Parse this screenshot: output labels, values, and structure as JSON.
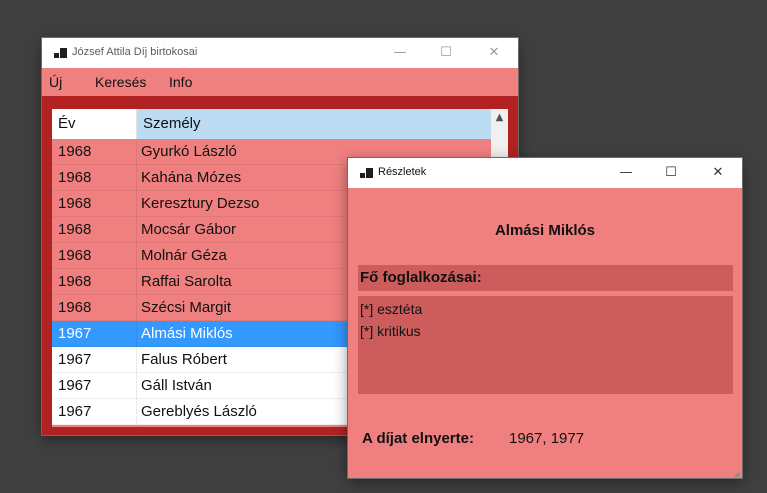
{
  "main_window": {
    "title": "József Attila Díj birtokosai",
    "menu": [
      "Új",
      "Keresés",
      "Info"
    ],
    "list": {
      "columns": [
        "Év",
        "Személy"
      ],
      "rows": [
        {
          "ev": "1968",
          "szemely": "Gyurkó László"
        },
        {
          "ev": "1968",
          "szemely": "Kahána Mózes"
        },
        {
          "ev": "1968",
          "szemely": "Keresztury Dezso"
        },
        {
          "ev": "1968",
          "szemely": "Mocsár Gábor"
        },
        {
          "ev": "1968",
          "szemely": "Molnár Géza"
        },
        {
          "ev": "1968",
          "szemely": "Raffai Sarolta"
        },
        {
          "ev": "1968",
          "szemely": "Szécsi Margit"
        },
        {
          "ev": "1967",
          "szemely": "Almási Miklós"
        },
        {
          "ev": "1967",
          "szemely": "Falus Róbert"
        },
        {
          "ev": "1967",
          "szemely": "Gáll István"
        },
        {
          "ev": "1967",
          "szemely": "Gereblyés László"
        }
      ],
      "selected_index": 7
    }
  },
  "details_window": {
    "title": "Részletek",
    "name": "Almási Miklós",
    "occupations_label": "Fő foglalkozásai:",
    "occupations": [
      "[*] esztéta",
      "[*] kritikus"
    ],
    "award_label": "A díjat elnyerte:",
    "award_years": "1967, 1977"
  },
  "caption_buttons": {
    "minimize": "—",
    "maximize": "☐",
    "close": "✕"
  },
  "colors": {
    "desktop": "#404040",
    "form_back": "#f08080",
    "client_back": "#b22222",
    "panel_back": "#cd5c5c",
    "selection": "#3399ff",
    "header_highlight": "#bcdcf4"
  }
}
